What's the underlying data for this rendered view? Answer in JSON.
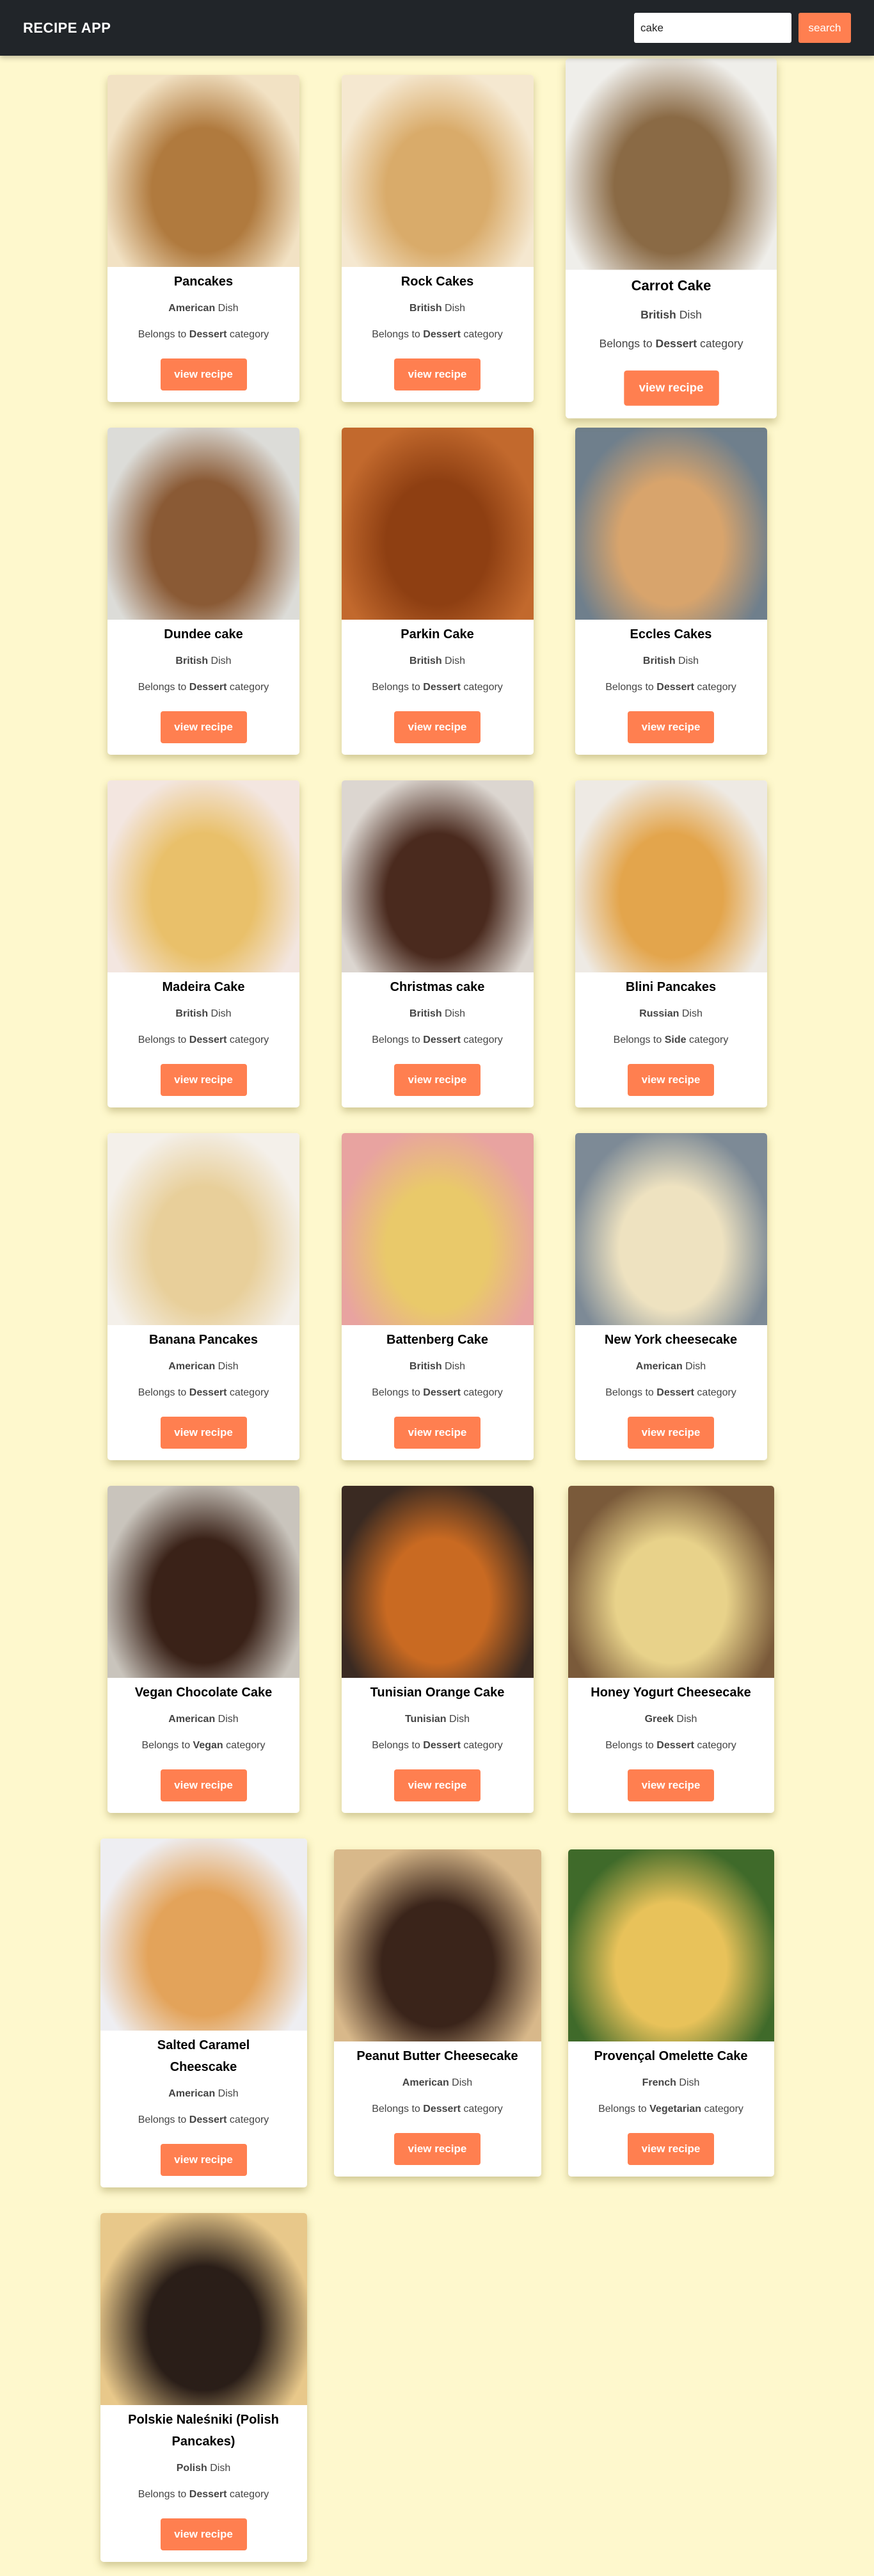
{
  "header": {
    "title": "RECIPE APP",
    "search_value": "cake",
    "search_button": "search"
  },
  "labels": {
    "dish_suffix": "Dish",
    "belongs_to": "Belongs to",
    "category_suffix": "category",
    "view_button": "view recipe"
  },
  "colors": {
    "accent": "#ff7f50",
    "header_bg": "#212529",
    "page_bg": "#fef8cd"
  },
  "recipes": [
    {
      "title": "Pancakes",
      "area": "American",
      "category": "Dessert",
      "image_tone": [
        "#b07a3e",
        "#f2e2c4"
      ]
    },
    {
      "title": "Rock Cakes",
      "area": "British",
      "category": "Dessert",
      "image_tone": [
        "#d9ab6a",
        "#f5e8d0"
      ]
    },
    {
      "title": "Carrot Cake",
      "area": "British",
      "category": "Dessert",
      "image_tone": [
        "#8a6a45",
        "#efeeea"
      ]
    },
    {
      "title": "Dundee cake",
      "area": "British",
      "category": "Dessert",
      "image_tone": [
        "#8a5a35",
        "#dcdcd8"
      ]
    },
    {
      "title": "Parkin Cake",
      "area": "British",
      "category": "Dessert",
      "image_tone": [
        "#8e3f12",
        "#c2692d"
      ]
    },
    {
      "title": "Eccles Cakes",
      "area": "British",
      "category": "Dessert",
      "image_tone": [
        "#d8a46c",
        "#6f7f8c"
      ]
    },
    {
      "title": "Madeira Cake",
      "area": "British",
      "category": "Dessert",
      "image_tone": [
        "#e9c06a",
        "#f3e6e0"
      ]
    },
    {
      "title": "Christmas cake",
      "area": "British",
      "category": "Dessert",
      "image_tone": [
        "#4a2a1e",
        "#dcd6d0"
      ]
    },
    {
      "title": "Blini Pancakes",
      "area": "Russian",
      "category": "Side",
      "image_tone": [
        "#e3a54c",
        "#eeeae4"
      ]
    },
    {
      "title": "Banana Pancakes",
      "area": "American",
      "category": "Dessert",
      "image_tone": [
        "#e8cf9a",
        "#f4f0ea"
      ]
    },
    {
      "title": "Battenberg Cake",
      "area": "British",
      "category": "Dessert",
      "image_tone": [
        "#e9c96a",
        "#e8a3a0"
      ]
    },
    {
      "title": "New York cheesecake",
      "area": "American",
      "category": "Dessert",
      "image_tone": [
        "#eee2c0",
        "#7d8a96"
      ]
    },
    {
      "title": "Vegan Chocolate Cake",
      "area": "American",
      "category": "Vegan",
      "image_tone": [
        "#3a2218",
        "#c9c4bc"
      ]
    },
    {
      "title": "Tunisian Orange Cake",
      "area": "Tunisian",
      "category": "Dessert",
      "image_tone": [
        "#c96a22",
        "#3a2a22"
      ]
    },
    {
      "title": "Honey Yogurt Cheesecake",
      "area": "Greek",
      "category": "Dessert",
      "image_tone": [
        "#e8d28a",
        "#7a5a3a"
      ]
    },
    {
      "title": "Salted Caramel Cheescake",
      "area": "American",
      "category": "Dessert",
      "image_tone": [
        "#e3a35a",
        "#eeeef2"
      ]
    },
    {
      "title": "Peanut Butter Cheesecake",
      "area": "American",
      "category": "Dessert",
      "image_tone": [
        "#3a241a",
        "#d8b88a"
      ]
    },
    {
      "title": "Provençal Omelette Cake",
      "area": "French",
      "category": "Vegetarian",
      "image_tone": [
        "#e8c25a",
        "#3f6a2a"
      ]
    },
    {
      "title": "Polskie Naleśniki (Polish Pancakes)",
      "area": "Polish",
      "category": "Dessert",
      "image_tone": [
        "#2a1e18",
        "#e8c88a"
      ]
    }
  ]
}
